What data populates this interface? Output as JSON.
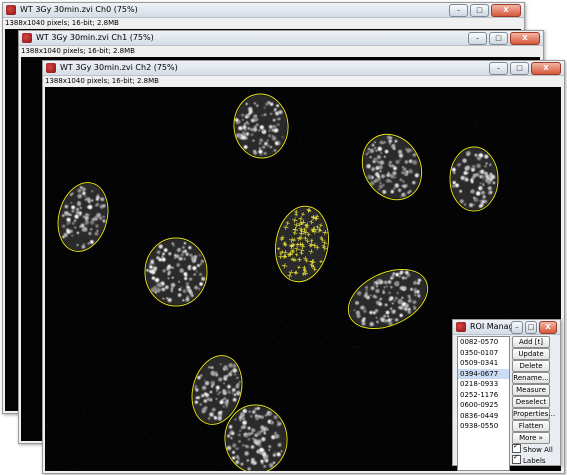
{
  "windows": [
    {
      "id": "ch0",
      "title": "WT 3Gy 30min.zvi  Ch0 (75%)",
      "info": "1388x1040 pixels; 16-bit; 2.8MB"
    },
    {
      "id": "ch1",
      "title": "WT 3Gy 30min.zvi  Ch1 (75%)",
      "info": "1388x1040 pixels; 16-bit; 2.8MB"
    },
    {
      "id": "ch2",
      "title": "WT 3Gy 30min.zvi  Ch2 (75%)",
      "info": "1388x1040 pixels; 16-bit; 2.8MB"
    }
  ],
  "window_buttons": {
    "minimize": "–",
    "maximize": "□",
    "close": "X"
  },
  "roi_manager": {
    "title": "ROI Manager",
    "items": [
      "0082-0570",
      "0350-0107",
      "0509-0341",
      "0394-0677",
      "0218-0933",
      "0252-1176",
      "0600-0925",
      "0836-0449",
      "0938-0550"
    ],
    "selected_index": 3,
    "buttons": [
      "Add [t]",
      "Update",
      "Delete",
      "Rename...",
      "Measure",
      "Deselect",
      "Properties...",
      "Flatten [F]",
      "More »"
    ],
    "show_all_label": "Show All",
    "show_all_checked": true,
    "labels_label": "Labels",
    "labels_checked": true
  },
  "colors": {
    "roi_outline": "#e6e01e",
    "roi_selected": "#e8e23a",
    "image_background": "#040404"
  },
  "icons": {
    "window_icon": "imagej-window-icon"
  }
}
